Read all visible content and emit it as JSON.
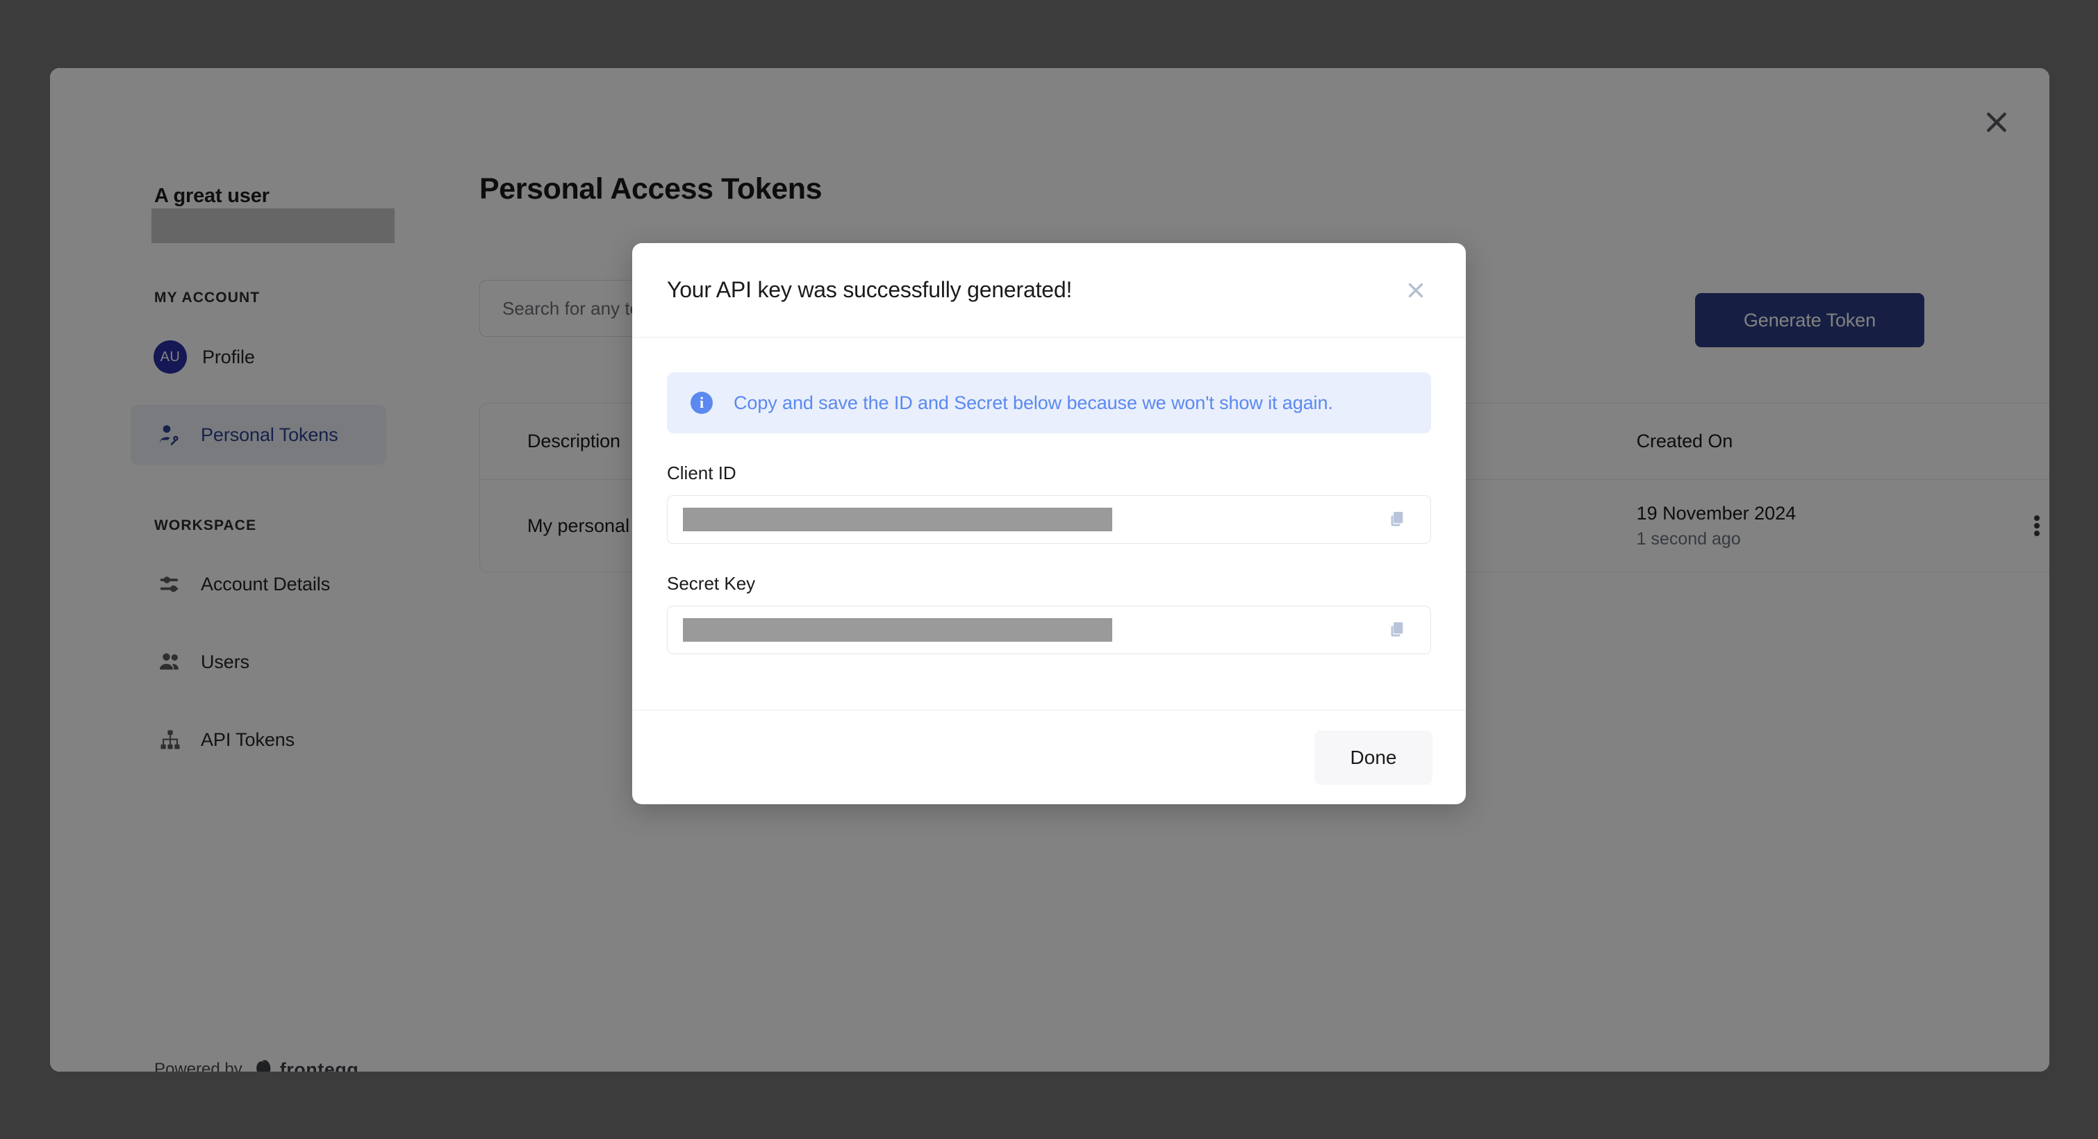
{
  "panel": {
    "close_icon": "close-icon"
  },
  "sidebar": {
    "user_name": "A great user",
    "sections": [
      {
        "label": "MY ACCOUNT"
      },
      {
        "label": "WORKSPACE"
      }
    ],
    "my_account_items": [
      {
        "label": "Profile",
        "icon": "avatar",
        "avatar_initials": "AU",
        "active": false
      },
      {
        "label": "Personal Tokens",
        "icon": "user-key-icon",
        "active": true
      }
    ],
    "workspace_items": [
      {
        "label": "Account Details",
        "icon": "sliders-icon"
      },
      {
        "label": "Users",
        "icon": "users-icon"
      },
      {
        "label": "API Tokens",
        "icon": "sitemap-icon"
      }
    ],
    "footer": {
      "powered_by": "Powered by",
      "brand": "frontegg",
      "brand_icon": "frontegg-egg-icon"
    }
  },
  "main": {
    "page_title": "Personal Access Tokens",
    "search": {
      "placeholder": "Search for any text...",
      "value": "",
      "icon": "search-icon"
    },
    "generate_token_label": "Generate Token",
    "table": {
      "columns": [
        "Description",
        "Created On"
      ],
      "rows": [
        {
          "description": "My personal token",
          "created_on": "19 November 2024",
          "created_relative": "1 second ago",
          "menu_icon": "kebab-menu-icon"
        }
      ]
    }
  },
  "modal": {
    "title": "Your API key was successfully generated!",
    "close_icon": "close-icon",
    "info": {
      "icon": "info-icon",
      "text": "Copy and save the ID and Secret below because we won't show it again."
    },
    "fields": [
      {
        "label": "Client ID",
        "value": "",
        "redacted": true,
        "copy_icon": "copy-icon"
      },
      {
        "label": "Secret Key",
        "value": "",
        "redacted": true,
        "copy_icon": "copy-icon"
      }
    ],
    "done_label": "Done"
  },
  "colors": {
    "accent_blue": "#2b3e84",
    "active_nav_text": "#2c4494",
    "avatar_bg": "#2c2fa8",
    "info_bg": "#e9effc",
    "info_fg": "#5b89f0",
    "copy_icon": "#b8c4d9",
    "page_bg": "#3c3c3c"
  }
}
